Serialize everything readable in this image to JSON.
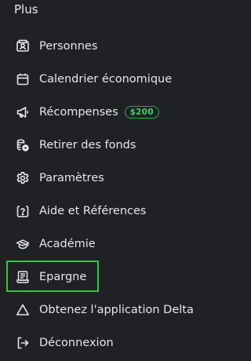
{
  "menu": {
    "title": "Plus",
    "items": [
      {
        "label": "Personnes",
        "icon": "contact-card-icon"
      },
      {
        "label": "Calendrier économique",
        "icon": "calendar-icon"
      },
      {
        "label": "Récompenses",
        "icon": "megaphone-icon",
        "badge": "$200"
      },
      {
        "label": "Retirer des fonds",
        "icon": "coins-withdraw-icon"
      },
      {
        "label": "Paramètres",
        "icon": "gear-icon"
      },
      {
        "label": "Aide et Références",
        "icon": "help-question-icon"
      },
      {
        "label": "Académie",
        "icon": "graduation-cap-icon"
      },
      {
        "label": "Epargne",
        "icon": "savings-scroll-icon"
      },
      {
        "label": "Obtenez l'application Delta",
        "icon": "delta-triangle-icon"
      },
      {
        "label": "Déconnexion",
        "icon": "logout-icon"
      }
    ]
  },
  "colors": {
    "background": "#1f2124",
    "text": "#e6e7e9",
    "badge_accent": "#3ccf63",
    "highlight_box": "#37c43f"
  }
}
